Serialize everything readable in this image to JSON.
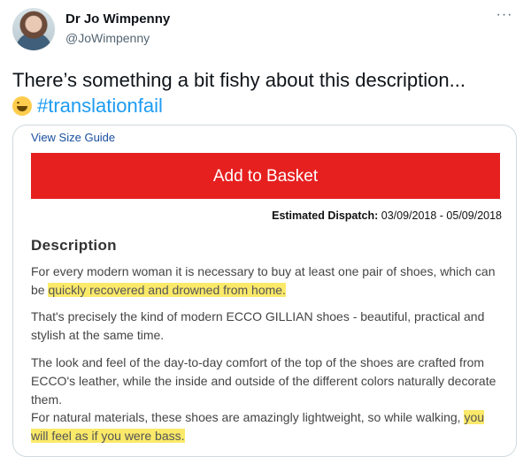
{
  "author": {
    "name": "Dr Jo Wimpenny",
    "handle": "@JoWimpenny"
  },
  "tweet": {
    "text": "There’s something a bit fishy about this description...",
    "emoji": "grinning-face-with-sweat",
    "hashtag": "#translationfail"
  },
  "card": {
    "size_guide": "View Size Guide",
    "basket_button": "Add to Basket",
    "dispatch_label": "Estimated Dispatch:",
    "dispatch_dates": "03/09/2018 - 05/09/2018",
    "description_heading": "Description",
    "paragraphs": {
      "p1_a": "For every modern woman it is necessary to buy at least one pair of shoes, which can be ",
      "p1_hl": "quickly recovered and drowned from home.",
      "p2": "That's precisely the kind of modern ECCO GILLIAN shoes - beautiful, practical and stylish at the same time.",
      "p3": "The look and feel of the day-to-day comfort of the top of the shoes are crafted from ECCO's leather, while the inside and outside of the different colors naturally decorate them.",
      "p4_a": "For natural materials, these shoes are amazingly lightweight, so while walking, ",
      "p4_hl": "you will feel as if you were bass."
    }
  },
  "colors": {
    "accent": "#1d9bf0",
    "button": "#e5201f",
    "highlight": "#fbe96a"
  }
}
